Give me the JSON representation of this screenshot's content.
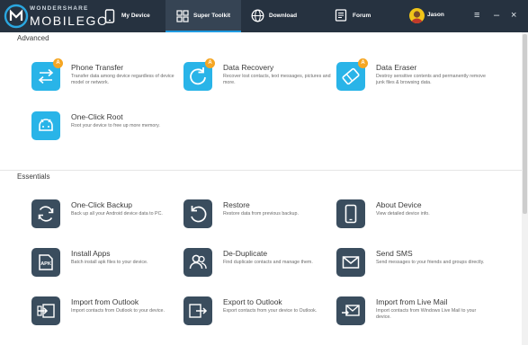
{
  "app": {
    "brand_top": "WONDERSHARE",
    "brand_main": "MOBILEGO",
    "logo_icon": "mobilego-logo-icon"
  },
  "nav": {
    "tabs": [
      {
        "label": "My Device",
        "icon": "phone-icon",
        "active": false
      },
      {
        "label": "Super Toolkit",
        "icon": "grid-icon",
        "active": true
      },
      {
        "label": "Download",
        "icon": "globe-icon",
        "active": false
      },
      {
        "label": "Forum",
        "icon": "forum-icon",
        "active": false
      }
    ],
    "user": {
      "name": "Jason",
      "avatar_icon": "avatar-icon"
    },
    "controls": {
      "menu": "≡",
      "minimize": "–",
      "close": "×"
    }
  },
  "colors": {
    "topbar": "#263240",
    "active_tab": "#364454",
    "accent": "#1f9ae0",
    "icon_blue": "#29b4e8",
    "icon_gray": "#3a4d5e",
    "badge": "#f5a623"
  },
  "sections": {
    "advanced": {
      "title": "Advanced",
      "tools": [
        {
          "title": "Phone Transfer",
          "desc": "Transfer data among device regardless of device model or network.",
          "icon": "phone-transfer-icon",
          "badge": "A"
        },
        {
          "title": "Data Recovery",
          "desc": "Recover lost contacts, text messages, pictures and more.",
          "icon": "data-recovery-icon",
          "badge": "A"
        },
        {
          "title": "Data Eraser",
          "desc": "Destroy sensitive contents and permanently remove junk files & browsing data.",
          "icon": "data-eraser-icon",
          "badge": "A"
        },
        {
          "title": "One-Click Root",
          "desc": "Root your device to free up more memory.",
          "icon": "android-root-icon",
          "badge": ""
        }
      ]
    },
    "essentials": {
      "title": "Essentials",
      "tools": [
        {
          "title": "One-Click Backup",
          "desc": "Back up all your Android device data to PC.",
          "icon": "backup-icon"
        },
        {
          "title": "Restore",
          "desc": "Restore data from previous backup.",
          "icon": "restore-icon"
        },
        {
          "title": "About Device",
          "desc": "View detailed device info.",
          "icon": "device-info-icon"
        },
        {
          "title": "Install Apps",
          "desc": "Batch install apk files to your device.",
          "icon": "apk-icon"
        },
        {
          "title": "De-Duplicate",
          "desc": "Find duplicate contacts and manage them.",
          "icon": "contacts-icon"
        },
        {
          "title": "Send SMS",
          "desc": "Send messages to your friends and groups directly.",
          "icon": "envelope-icon"
        },
        {
          "title": "Import from Outlook",
          "desc": "Import contacts from Outlook to your device.",
          "icon": "import-outlook-icon"
        },
        {
          "title": "Export to Outlook",
          "desc": "Export contacts from your device to Outlook.",
          "icon": "export-outlook-icon"
        },
        {
          "title": "Import from Live Mail",
          "desc": "Import contacts from Windows Live Mail to your device.",
          "icon": "live-mail-icon"
        }
      ]
    }
  }
}
